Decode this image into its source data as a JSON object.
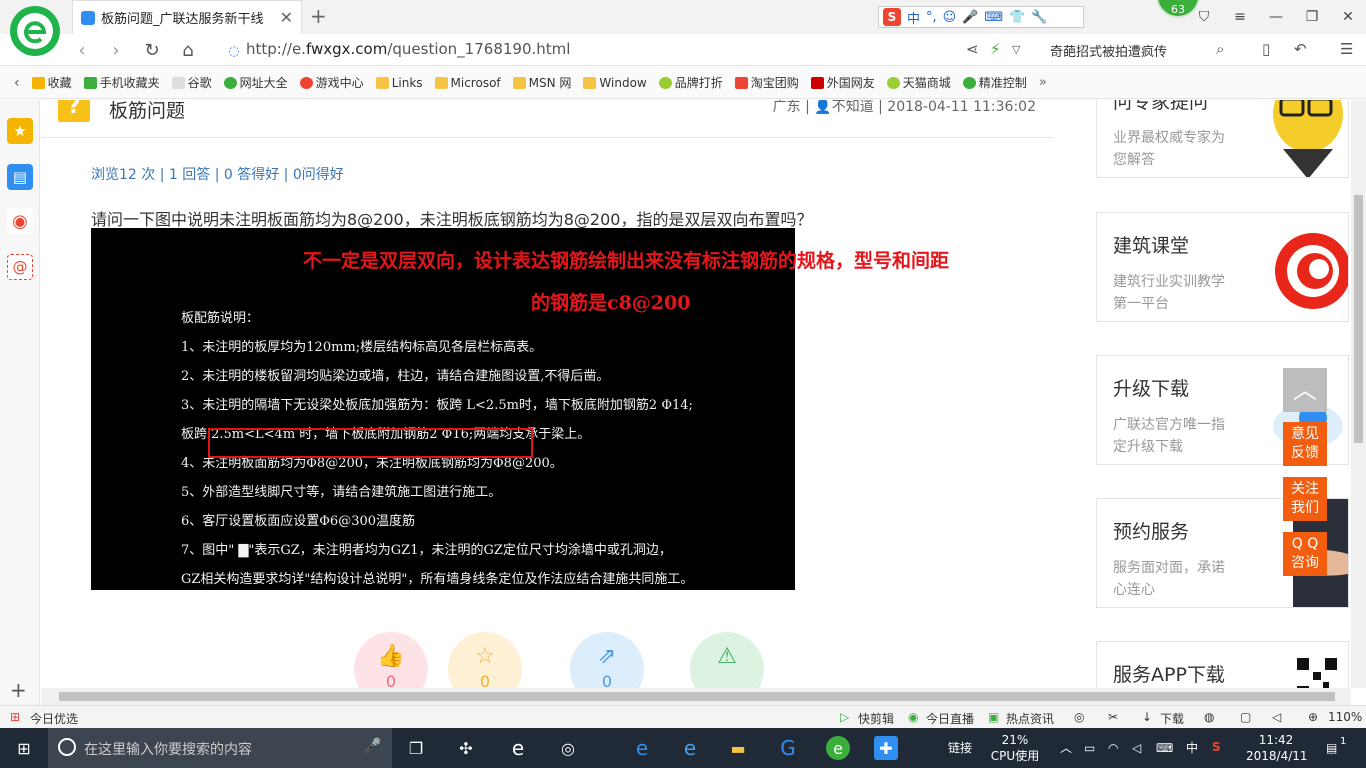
{
  "browser": {
    "tab_title": "板筋问题_广联达服务新干线",
    "url_prefix": "http://e.",
    "url_domain": "fwxgx.com",
    "url_path": "/question_1768190.html",
    "news_ticker": "奇葩招式被拍遭疯传",
    "ime_lang": "中",
    "ime_punct": "°,",
    "badge_count": "63"
  },
  "bookmarks": [
    "收藏",
    "手机收藏夹",
    "谷歌",
    "网址大全",
    "游戏中心",
    "Links",
    "Microsof",
    "MSN 网",
    "Window",
    "品牌打折",
    "淘宝团购",
    "外国网友",
    "天猫商城",
    "精准控制"
  ],
  "question": {
    "title": "板筋问题",
    "meta": "广东 | 👤不知道 | 2018-04-11 11:36:02",
    "stats": "浏览12 次 | 1 回答 | 0 答得好 | 0问得好",
    "text": "请问一下图中说明未注明板面筋均为8@200，未注明板底钢筋均为8@200，指的是双层双向布置吗？",
    "answer_line1": "不一定是双层双向，设计表达钢筋绘制出来没有标注钢筋的规格，型号和间距",
    "answer_line2": "的钢筋是c8@200",
    "notes": [
      "板配筋说明：",
      "1、未注明的板厚均为120mm;楼层结构标高见各层栏标高表。",
      "2、未注明的楼板留洞均贴梁边或墙，柱边，请结合建施图设置,不得后凿。",
      "3、未注明的隔墙下无设梁处板底加强筋为：板跨 L<2.5m时，墙下板底附加钢筋2 Φ14;",
      "    板跨 2.5m<L<4m 时，墙下板底附加钢筋2 Φ16;两端均支承于梁上。",
      "4、未注明板面筋均为Φ8@200，未注明板底钢筋均为Φ8@200。",
      "5、外部造型线脚尺寸等，请结合建筑施工图进行施工。",
      "6、客厅设置板面应设置Φ6@300温度筋",
      "7、图中\" ▇\"表示GZ，未注明者均为GZ1，未注明的GZ定位尺寸均涂墙中或孔洞边，",
      "    GZ相关构造要求均详\"结构设计总说明\"，所有墙身线条定位及作法应结合建施共同施工。"
    ],
    "actions": [
      "0",
      "0",
      "0"
    ]
  },
  "cards": [
    {
      "title": "问专家提问",
      "desc": "业界最权威专家为您解答"
    },
    {
      "title": "建筑课堂",
      "desc": "建筑行业实训教学第一平台"
    },
    {
      "title": "升级下载",
      "desc": "广联达官方唯一指定升级下载"
    },
    {
      "title": "预约服务",
      "desc": "服务面对面，承诺心连心"
    },
    {
      "title": "服务APP下载",
      "desc": ""
    }
  ],
  "float": {
    "feedback": "意见\n反馈",
    "follow": "关注\n我们",
    "qq": "Q Q\n咨询"
  },
  "statusbar": {
    "left": "今日优选",
    "items": [
      "快剪辑",
      "今日直播",
      "热点资讯",
      "下载"
    ],
    "zoom": "110%"
  },
  "taskbar": {
    "search_placeholder": "在这里输入你要搜索的内容",
    "link": "链接",
    "cpu_pct": "21%",
    "cpu_label": "CPU使用",
    "ime": "中",
    "time": "11:42",
    "date": "2018/4/11",
    "notif": "1"
  },
  "colors": {
    "accent": "#1fb44b",
    "answer_red": "#e5161b",
    "link_blue": "#3a74b7",
    "float_orange": "#f25d0f"
  }
}
